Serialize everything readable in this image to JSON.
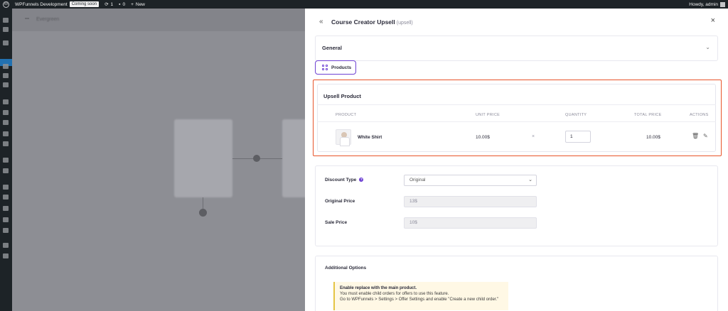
{
  "admin_bar": {
    "site_name": "WPFunnels Development",
    "coming_soon_badge": "Coming soon",
    "updates_count": "1",
    "comments_count": "0",
    "new_label": "New",
    "greeting": "Howdy, admin"
  },
  "canvas": {
    "title": "Evergreen"
  },
  "panel": {
    "title": "Course Creator Upsell",
    "subtitle": "(upsell)",
    "general_label": "General",
    "products_tab_label": "Products",
    "upsell": {
      "title": "Upsell Product",
      "columns": {
        "product": "PRODUCT",
        "unit_price": "UNIT PRICE",
        "quantity": "QUANTITY",
        "total_price": "TOTAL PRICE",
        "actions": "ACTIONS"
      },
      "row": {
        "name": "White Shirt",
        "unit_price": "10.00$",
        "multiply": "×",
        "quantity": "1",
        "total_price": "10.00$"
      }
    },
    "discount": {
      "type_label": "Discount Type",
      "type_value": "Original",
      "original_price_label": "Original Price",
      "original_price_value": "13$",
      "sale_price_label": "Sale Price",
      "sale_price_value": "10$"
    },
    "additional": {
      "title": "Additional Options",
      "notice_title": "Enable replace with the main product.",
      "notice_line1": "You must enable child orders for offers to use this feature.",
      "notice_line2": "Go to WPFunnels > Settings > Offer Settings and enable \"Create a new child order.\""
    }
  },
  "colors": {
    "accent": "#6e42d3",
    "highlight": "#e8542a",
    "admin_bar": "#1d2327",
    "notice_bg": "#fff8e5"
  },
  "icons": [
    "wordpress-logo-icon",
    "updates-icon",
    "comments-icon",
    "plus-icon",
    "collapse-icon",
    "close-icon",
    "chevron-down-icon",
    "grid-icon",
    "trash-icon",
    "edit-icon",
    "info-icon"
  ]
}
